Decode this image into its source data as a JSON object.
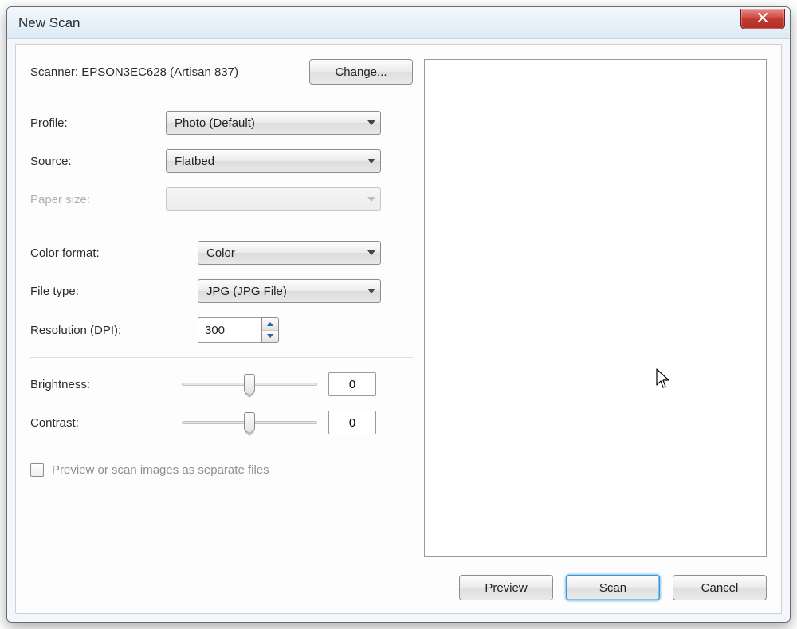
{
  "window": {
    "title": "New Scan"
  },
  "scanner": {
    "label_prefix": "Scanner:",
    "name": "EPSON3EC628 (Artisan 837)",
    "change_button": "Change..."
  },
  "fields": {
    "profile": {
      "label": "Profile:",
      "value": "Photo (Default)"
    },
    "source": {
      "label": "Source:",
      "value": "Flatbed"
    },
    "paper_size": {
      "label": "Paper size:",
      "value": ""
    },
    "color_format": {
      "label": "Color format:",
      "value": "Color"
    },
    "file_type": {
      "label": "File type:",
      "value": "JPG (JPG File)"
    },
    "resolution": {
      "label": "Resolution (DPI):",
      "value": "300"
    },
    "brightness": {
      "label": "Brightness:",
      "value": "0"
    },
    "contrast": {
      "label": "Contrast:",
      "value": "0"
    }
  },
  "checkbox": {
    "separate_files_label": "Preview or scan images as separate files",
    "checked": false
  },
  "footer": {
    "preview": "Preview",
    "scan": "Scan",
    "cancel": "Cancel"
  }
}
